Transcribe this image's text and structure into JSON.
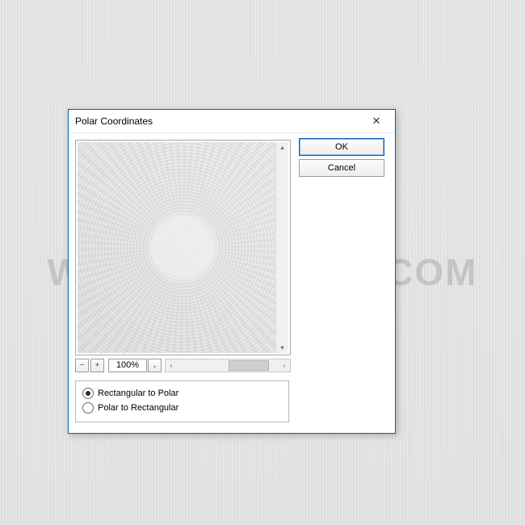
{
  "watermark": "WWW.PSD-DUDE.COM",
  "dialog": {
    "title": "Polar Coordinates",
    "close_label": "✕",
    "zoom": {
      "minus": "−",
      "plus": "+",
      "value": "100%",
      "drop": "⌄"
    },
    "options": {
      "opt1": "Rectangular to Polar",
      "opt2": "Polar to Rectangular",
      "selected": "opt1"
    },
    "buttons": {
      "ok": "OK",
      "cancel": "Cancel"
    },
    "scroll": {
      "up": "▴",
      "down": "▾",
      "left": "‹",
      "right": "›"
    }
  }
}
